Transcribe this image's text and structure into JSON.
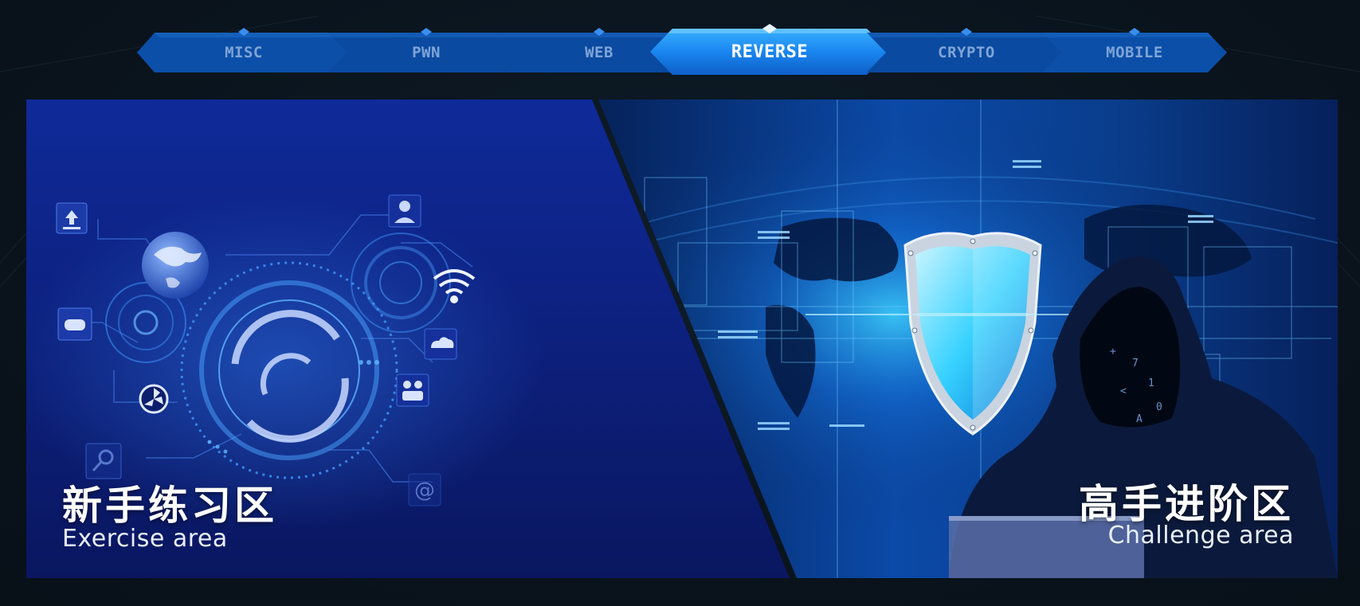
{
  "tabs": [
    {
      "label": "MISC",
      "active": false
    },
    {
      "label": "PWN",
      "active": false
    },
    {
      "label": "WEB",
      "active": false
    },
    {
      "label": "REVERSE",
      "active": true
    },
    {
      "label": "CRYPTO",
      "active": false
    },
    {
      "label": "MOBILE",
      "active": false
    }
  ],
  "panels": {
    "exercise": {
      "title": "新手练习区",
      "subtitle": "Exercise area"
    },
    "challenge": {
      "title": "高手进阶区",
      "subtitle": "Challenge area"
    }
  },
  "colors": {
    "background": "#0a141d",
    "tab_inactive": "#0b4fa8",
    "tab_active": "#1a86f0",
    "tab_text": "#7fa4d6",
    "exercise_panel": "#0d2583",
    "challenge_panel": "#0b3d8c",
    "glow": "#3fd6ff"
  },
  "icons": [
    "globe-icon",
    "upload-icon",
    "user-icon",
    "wifi-icon",
    "gamepad-icon",
    "cloud-icon",
    "group-icon",
    "aperture-icon",
    "key-icon",
    "at-icon",
    "shield-icon",
    "hacker-figure"
  ]
}
